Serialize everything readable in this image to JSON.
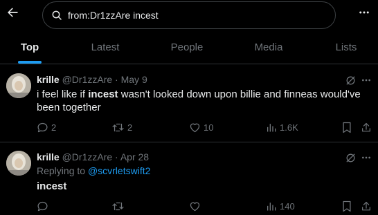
{
  "search": {
    "query": "from:Dr1zzAre incest"
  },
  "tabs": [
    {
      "label": "Top",
      "active": true
    },
    {
      "label": "Latest",
      "active": false
    },
    {
      "label": "People",
      "active": false
    },
    {
      "label": "Media",
      "active": false
    },
    {
      "label": "Lists",
      "active": false
    }
  ],
  "tweets": [
    {
      "name": "krille",
      "handle": "@Dr1zzAre",
      "separator": "·",
      "date": "May 9",
      "text_before": "i feel like if ",
      "text_highlight": "incest",
      "text_after": " wasn't looked down upon billie and finneas would've been together",
      "replies": "2",
      "reposts": "2",
      "likes": "10",
      "views": "1.6K"
    },
    {
      "name": "krille",
      "handle": "@Dr1zzAre",
      "separator": "·",
      "date": "Apr 28",
      "replying_label": "Replying to ",
      "replying_to": "@scvrletswift2",
      "text_highlight": "incest",
      "replies": "",
      "reposts": "",
      "likes": "",
      "views": "140"
    }
  ],
  "icons": {
    "back": "arrow-left-icon",
    "search": "search-icon",
    "more": "more-horizontal-icon",
    "grok": "grok-icon",
    "reply": "reply-icon",
    "repost": "repost-icon",
    "like": "heart-icon",
    "views": "views-chart-icon",
    "bookmark": "bookmark-icon",
    "share": "share-icon"
  },
  "colors": {
    "background": "#000000",
    "text": "#e7e9ea",
    "muted": "#71767b",
    "accent": "#1d9bf0",
    "border": "#2f3336"
  }
}
